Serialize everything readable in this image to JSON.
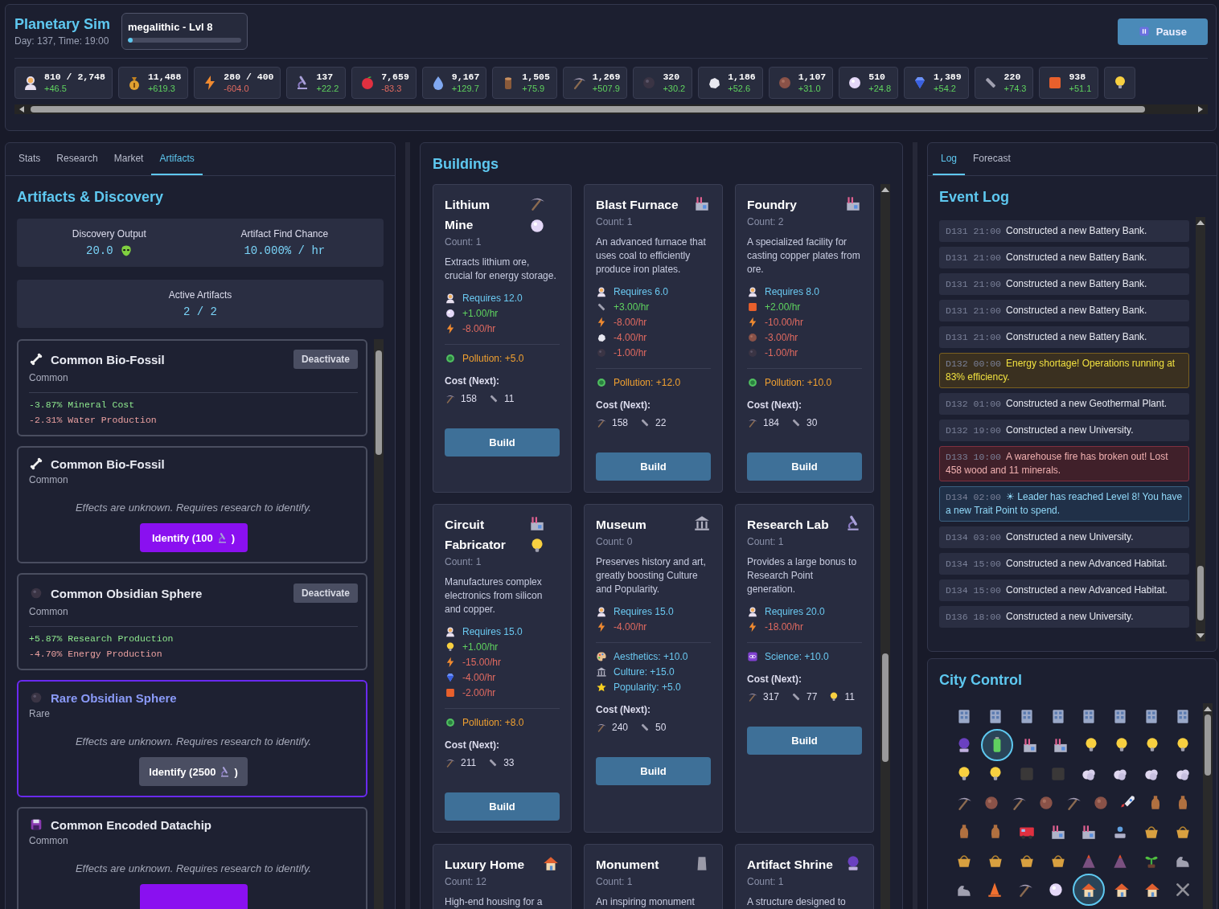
{
  "header": {
    "title": "Planetary Sim",
    "subtitle": "Day: 137, Time: 19:00",
    "leader": {
      "label": "megalithic - Lvl 8",
      "level": 0.03
    },
    "pause_button": "Pause"
  },
  "resources": [
    {
      "kind": "colonist",
      "amount": "810 / 2,748",
      "rate": "+46.5",
      "negative": false
    },
    {
      "kind": "money",
      "amount": "11,488",
      "rate": "+619.3",
      "negative": false
    },
    {
      "kind": "energy",
      "amount": "280 / 400",
      "rate": "-604.0",
      "negative": true
    },
    {
      "kind": "microscope",
      "amount": "137",
      "rate": "+22.2",
      "negative": false
    },
    {
      "kind": "apple",
      "amount": "7,659",
      "rate": "-83.3",
      "negative": true
    },
    {
      "kind": "water",
      "amount": "9,167",
      "rate": "+129.7",
      "negative": false
    },
    {
      "kind": "wood",
      "amount": "1,505",
      "rate": "+75.9",
      "negative": false
    },
    {
      "kind": "pick",
      "amount": "1,269",
      "rate": "+507.9",
      "negative": false
    },
    {
      "kind": "coal",
      "amount": "320",
      "rate": "+30.2",
      "negative": false
    },
    {
      "kind": "rock",
      "amount": "1,186",
      "rate": "+52.6",
      "negative": false
    },
    {
      "kind": "copper",
      "amount": "1,107",
      "rate": "+31.0",
      "negative": false
    },
    {
      "kind": "lithium",
      "amount": "510",
      "rate": "+24.8",
      "negative": false
    },
    {
      "kind": "gem",
      "amount": "1,389",
      "rate": "+54.2",
      "negative": false
    },
    {
      "kind": "steel",
      "amount": "220",
      "rate": "+74.3",
      "negative": false
    },
    {
      "kind": "plate",
      "amount": "938",
      "rate": "+51.1",
      "negative": false
    },
    {
      "kind": "bulb"
    }
  ],
  "left_panel": {
    "tabs": [
      {
        "label": "Stats",
        "selected": false
      },
      {
        "label": "Research",
        "selected": false
      },
      {
        "label": "Market",
        "selected": false
      },
      {
        "label": "Artifacts",
        "selected": true
      }
    ],
    "heading": "Artifacts & Discovery",
    "discovery": {
      "label": "Discovery Output",
      "value": "20.0"
    },
    "find_chance": {
      "label": "Artifact Find Chance",
      "value": "10.000% / hr"
    },
    "active": {
      "label": "Active Artifacts",
      "value": "2 / 2"
    },
    "artifacts": [
      {
        "kind": "bone",
        "name": "Common Bio-Fossil",
        "rarity": "Common",
        "rare": false,
        "action": "Deactivate",
        "effects": [
          {
            "text": "-3.87% Mineral Cost",
            "color": "#8ee88e"
          },
          {
            "text": "-2.31% Water Production",
            "color": "#eaa0a0"
          }
        ]
      },
      {
        "kind": "bone",
        "name": "Common Bio-Fossil",
        "rarity": "Common",
        "rare": false,
        "note": "Effects are unknown. Requires research to identify.",
        "identify": {
          "prefix": "Identify (100",
          "suffix": ")",
          "enabled": true
        }
      },
      {
        "kind": "coal",
        "name": "Common Obsidian Sphere",
        "rarity": "Common",
        "rare": false,
        "action": "Deactivate",
        "effects": [
          {
            "text": "+5.87% Research Production",
            "color": "#8ee88e"
          },
          {
            "text": "-4.70% Energy Production",
            "color": "#eaa0a0"
          }
        ]
      },
      {
        "kind": "coal",
        "name": "Rare Obsidian Sphere",
        "rarity": "Rare",
        "rare": true,
        "note": "Effects are unknown. Requires research to identify.",
        "identify": {
          "prefix": "Identify (2500",
          "suffix": ")",
          "enabled": false
        }
      },
      {
        "kind": "floppy",
        "name": "Common Encoded Datachip",
        "rarity": "Common",
        "rare": false,
        "note": "Effects are unknown. Requires research to identify.",
        "identify": {
          "enabled": true
        }
      }
    ]
  },
  "buildings": {
    "heading": "Buildings",
    "cards": [
      {
        "name": "Lithium Mine",
        "icons": [
          {
            "kind": "pick"
          },
          {
            "kind": "lithium"
          }
        ],
        "count": "Count: 1",
        "description": "Extracts lithium ore, crucial for energy storage.",
        "effects": [
          {
            "kind": "colonist",
            "text": "Requires 12.0",
            "color": "#6ac8f0"
          },
          {
            "kind": "lithium",
            "text": "+1.00/hr",
            "color": "#5fd35f"
          },
          {
            "kind": "energy",
            "text": "-8.00/hr",
            "color": "#e06a60"
          }
        ],
        "bonuses": [
          {
            "kind": "pollution",
            "text": "Pollution: +5.0",
            "color": "#f0a030"
          }
        ],
        "cost_label": "Cost (Next):",
        "cost": [
          {
            "kind": "pick",
            "amount": "158"
          },
          {
            "kind": "steel",
            "amount": "11"
          }
        ],
        "build": "Build"
      },
      {
        "name": "Blast Furnace",
        "icons": [
          {
            "kind": "factory"
          }
        ],
        "count": "Count: 1",
        "description": "An advanced furnace that uses coal to efficiently produce iron plates.",
        "effects": [
          {
            "kind": "colonist",
            "text": "Requires 6.0",
            "color": "#6ac8f0"
          },
          {
            "kind": "steel",
            "text": "+3.00/hr",
            "color": "#5fd35f"
          },
          {
            "kind": "energy",
            "text": "-8.00/hr",
            "color": "#e06a60"
          },
          {
            "kind": "rock",
            "text": "-4.00/hr",
            "color": "#e06a60"
          },
          {
            "kind": "coal",
            "text": "-1.00/hr",
            "color": "#e06a60"
          }
        ],
        "bonuses": [
          {
            "kind": "pollution",
            "text": "Pollution: +12.0",
            "color": "#f0a030"
          }
        ],
        "cost_label": "Cost (Next):",
        "cost": [
          {
            "kind": "pick",
            "amount": "158"
          },
          {
            "kind": "steel",
            "amount": "22"
          }
        ],
        "build": "Build"
      },
      {
        "name": "Foundry",
        "icons": [
          {
            "kind": "factory"
          }
        ],
        "count": "Count: 2",
        "description": "A specialized facility for casting copper plates from ore.",
        "effects": [
          {
            "kind": "colonist",
            "text": "Requires 8.0",
            "color": "#6ac8f0"
          },
          {
            "kind": "plate",
            "text": "+2.00/hr",
            "color": "#5fd35f"
          },
          {
            "kind": "energy",
            "text": "-10.00/hr",
            "color": "#e06a60"
          },
          {
            "kind": "copper",
            "text": "-3.00/hr",
            "color": "#e06a60"
          },
          {
            "kind": "coal",
            "text": "-1.00/hr",
            "color": "#e06a60"
          }
        ],
        "bonuses": [
          {
            "kind": "pollution",
            "text": "Pollution: +10.0",
            "color": "#f0a030"
          }
        ],
        "cost_label": "Cost (Next):",
        "cost": [
          {
            "kind": "pick",
            "amount": "184"
          },
          {
            "kind": "steel",
            "amount": "30"
          }
        ],
        "build": "Build"
      },
      {
        "name": "Circuit Fabricator",
        "icons": [
          {
            "kind": "factory"
          },
          {
            "kind": "bulb"
          }
        ],
        "count": "Count: 1",
        "description": "Manufactures complex electronics from silicon and copper.",
        "effects": [
          {
            "kind": "colonist",
            "text": "Requires 15.0",
            "color": "#6ac8f0"
          },
          {
            "kind": "bulb",
            "text": "+1.00/hr",
            "color": "#5fd35f"
          },
          {
            "kind": "energy",
            "text": "-15.00/hr",
            "color": "#e06a60"
          },
          {
            "kind": "gem",
            "text": "-4.00/hr",
            "color": "#e06a60"
          },
          {
            "kind": "plate",
            "text": "-2.00/hr",
            "color": "#e06a60"
          }
        ],
        "bonuses": [
          {
            "kind": "pollution",
            "text": "Pollution: +8.0",
            "color": "#f0a030"
          }
        ],
        "cost_label": "Cost (Next):",
        "cost": [
          {
            "kind": "pick",
            "amount": "211"
          },
          {
            "kind": "steel",
            "amount": "33"
          }
        ],
        "build": "Build"
      },
      {
        "name": "Museum",
        "icons": [
          {
            "kind": "museum"
          }
        ],
        "count": "Count: 0",
        "description": "Preserves history and art, greatly boosting Culture and Popularity.",
        "effects": [
          {
            "kind": "colonist",
            "text": "Requires 15.0",
            "color": "#6ac8f0"
          },
          {
            "kind": "energy",
            "text": "-4.00/hr",
            "color": "#e06a60"
          }
        ],
        "bonuses": [
          {
            "kind": "palette",
            "text": "Aesthetics: +10.0",
            "color": "#6ac8f0"
          },
          {
            "kind": "museum",
            "text": "Culture: +15.0",
            "color": "#6ac8f0"
          },
          {
            "kind": "star",
            "text": "Popularity: +5.0",
            "color": "#6ac8f0"
          }
        ],
        "cost_label": "Cost (Next):",
        "cost": [
          {
            "kind": "pick",
            "amount": "240"
          },
          {
            "kind": "steel",
            "amount": "50"
          }
        ],
        "build": "Build"
      },
      {
        "name": "Research Lab",
        "icons": [
          {
            "kind": "microscope"
          }
        ],
        "count": "Count: 1",
        "description": "Provides a large bonus to Research Point generation.",
        "effects": [
          {
            "kind": "colonist",
            "text": "Requires 20.0",
            "color": "#6ac8f0"
          },
          {
            "kind": "energy",
            "text": "-18.00/hr",
            "color": "#e06a60"
          }
        ],
        "bonuses": [
          {
            "kind": "atom",
            "text": "Science: +10.0",
            "color": "#6ac8f0"
          }
        ],
        "cost_label": "Cost (Next):",
        "cost": [
          {
            "kind": "pick",
            "amount": "317"
          },
          {
            "kind": "steel",
            "amount": "77"
          },
          {
            "kind": "bulb",
            "amount": "11"
          }
        ],
        "build": "Build"
      },
      {
        "name": "Luxury Home",
        "icons": [
          {
            "kind": "house"
          }
        ],
        "count": "Count: 12",
        "description": "High-end housing for a"
      },
      {
        "name": "Monument",
        "icons": [
          {
            "kind": "moai"
          }
        ],
        "count": "Count: 1",
        "description": "An inspiring monument"
      },
      {
        "name": "Artifact Shrine",
        "icons": [
          {
            "kind": "crystal"
          }
        ],
        "count": "Count: 1",
        "description": "A structure designed to"
      }
    ]
  },
  "event_log": {
    "tabs": [
      {
        "label": "Log",
        "selected": true
      },
      {
        "label": "Forecast",
        "selected": false
      }
    ],
    "heading": "Event Log",
    "entries": [
      {
        "time": "D131 21:00",
        "text": "Constructed a new Battery Bank.",
        "kind": "plain"
      },
      {
        "time": "D131 21:00",
        "text": "Constructed a new Battery Bank.",
        "kind": "plain"
      },
      {
        "time": "D131 21:00",
        "text": "Constructed a new Battery Bank.",
        "kind": "plain"
      },
      {
        "time": "D131 21:00",
        "text": "Constructed a new Battery Bank.",
        "kind": "plain"
      },
      {
        "time": "D131 21:00",
        "text": "Constructed a new Battery Bank.",
        "kind": "plain"
      },
      {
        "time": "D132 00:00",
        "text": "Energy shortage! Operations running at 83% efficiency.",
        "kind": "warning"
      },
      {
        "time": "D132 01:00",
        "text": "Constructed a new Geothermal Plant.",
        "kind": "plain"
      },
      {
        "time": "D132 19:00",
        "text": "Constructed a new University.",
        "kind": "plain"
      },
      {
        "time": "D133 10:00",
        "text": "A warehouse fire has broken out! Lost 458 wood and 11 minerals.",
        "kind": "danger"
      },
      {
        "time": "D134 02:00",
        "text": "☀ Leader has reached Level 8! You have a new Trait Point to spend.",
        "kind": "milestone"
      },
      {
        "time": "D134 03:00",
        "text": "Constructed a new University.",
        "kind": "plain"
      },
      {
        "time": "D134 15:00",
        "text": "Constructed a new Advanced Habitat.",
        "kind": "plain"
      },
      {
        "time": "D134 15:00",
        "text": "Constructed a new Advanced Habitat.",
        "kind": "plain"
      },
      {
        "time": "D136 18:00",
        "text": "Constructed a new University.",
        "kind": "plain"
      }
    ]
  },
  "city_control": {
    "heading": "City Control",
    "rows": [
      [
        {
          "kind": "office",
          "selected": false
        },
        {
          "kind": "office",
          "selected": false
        },
        {
          "kind": "office",
          "selected": false
        },
        {
          "kind": "office",
          "selected": false
        },
        {
          "kind": "office",
          "selected": false
        },
        {
          "kind": "office",
          "selected": false
        },
        {
          "kind": "office",
          "selected": false
        },
        {
          "kind": "office",
          "selected": false
        }
      ],
      [
        {
          "kind": "crystal",
          "selected": false
        },
        {
          "kind": "battery",
          "selected": true
        },
        {
          "kind": "factory",
          "selected": false
        },
        {
          "kind": "factory",
          "selected": false
        },
        {
          "kind": "bulb",
          "selected": false
        },
        {
          "kind": "bulb",
          "selected": false
        },
        {
          "kind": "bulb",
          "selected": false
        },
        {
          "kind": "bulb",
          "selected": false
        }
      ],
      [
        {
          "kind": "bulb",
          "selected": false
        },
        {
          "kind": "bulb",
          "selected": false
        },
        {
          "kind": "chip",
          "selected": false
        },
        {
          "kind": "chip",
          "selected": false
        },
        {
          "kind": "cloud",
          "selected": false
        },
        {
          "kind": "cloud",
          "selected": false
        },
        {
          "kind": "cloud",
          "selected": false
        },
        {
          "kind": "cloud",
          "selected": false
        }
      ],
      [
        {
          "kind": "pick",
          "selected": false
        },
        {
          "kind": "copper",
          "selected": false
        },
        {
          "kind": "pick",
          "selected": false
        },
        {
          "kind": "copper",
          "selected": false
        },
        {
          "kind": "pick",
          "selected": false
        },
        {
          "kind": "copper",
          "selected": false
        },
        {
          "kind": "rocket",
          "selected": false
        },
        {
          "kind": "vase",
          "selected": false
        },
        {
          "kind": "vase",
          "selected": false
        }
      ],
      [
        {
          "kind": "vase",
          "selected": false
        },
        {
          "kind": "vase",
          "selected": false
        },
        {
          "kind": "truck",
          "selected": false
        },
        {
          "kind": "factory",
          "selected": false
        },
        {
          "kind": "factory",
          "selected": false
        },
        {
          "kind": "fountain",
          "selected": false
        },
        {
          "kind": "basket",
          "selected": false
        },
        {
          "kind": "basket",
          "selected": false
        }
      ],
      [
        {
          "kind": "basket",
          "selected": false
        },
        {
          "kind": "basket",
          "selected": false
        },
        {
          "kind": "basket",
          "selected": false
        },
        {
          "kind": "basket",
          "selected": false
        },
        {
          "kind": "volcano",
          "selected": false
        },
        {
          "kind": "volcano",
          "selected": false
        },
        {
          "kind": "sprout",
          "selected": false
        },
        {
          "kind": "arm",
          "selected": false
        }
      ],
      [
        {
          "kind": "arm",
          "selected": false
        },
        {
          "kind": "cone",
          "selected": false
        },
        {
          "kind": "pick",
          "selected": false
        },
        {
          "kind": "lithium",
          "selected": false
        },
        {
          "kind": "house",
          "selected": true
        },
        {
          "kind": "house",
          "selected": false
        },
        {
          "kind": "house",
          "selected": false
        },
        {
          "kind": "hammers",
          "selected": false
        }
      ]
    ]
  }
}
